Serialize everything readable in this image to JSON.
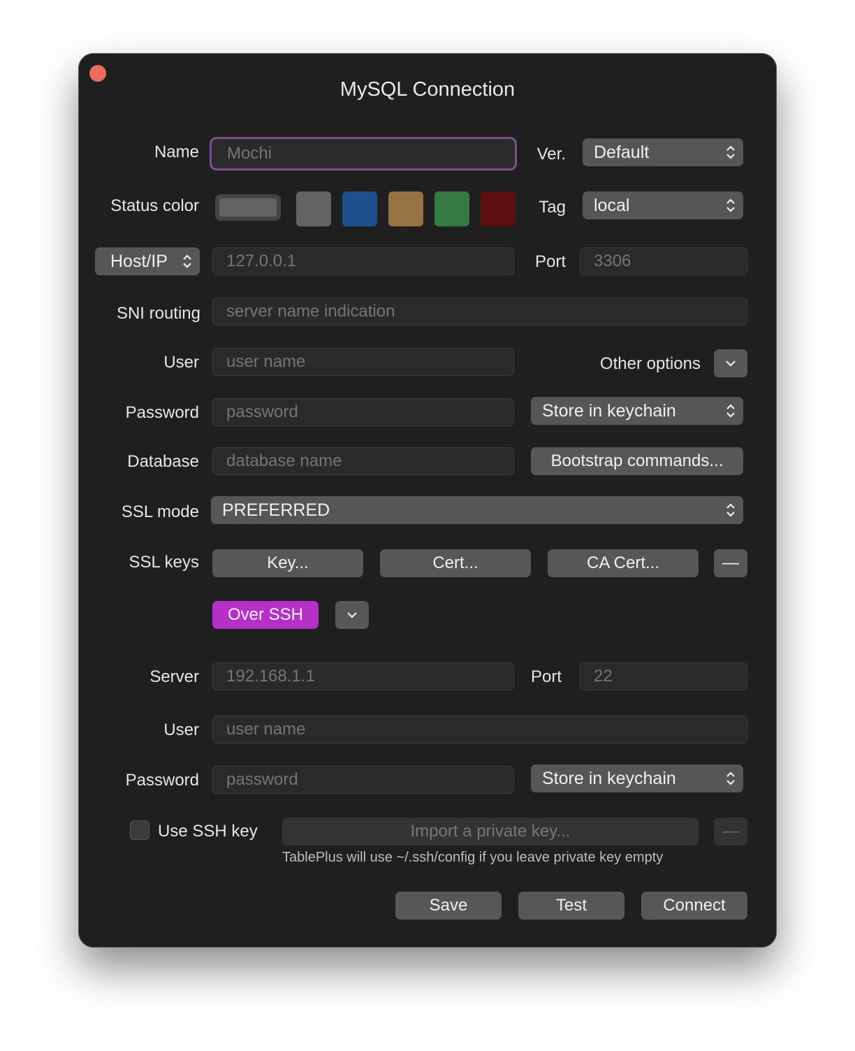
{
  "window": {
    "title": "MySQL Connection"
  },
  "colors": {
    "swatches": [
      "#636366",
      "#1f4f8f",
      "#967244",
      "#357a43",
      "#5c0f0e"
    ],
    "accent": "#b530c7"
  },
  "name": {
    "label": "Name",
    "placeholder": "Mochi"
  },
  "version": {
    "label": "Ver.",
    "value": "Default"
  },
  "status_color": {
    "label": "Status color"
  },
  "tag": {
    "label": "Tag",
    "value": "local"
  },
  "host": {
    "selector": "Host/IP",
    "placeholder": "127.0.0.1",
    "port_label": "Port",
    "port_placeholder": "3306"
  },
  "sni": {
    "label": "SNI routing",
    "placeholder": "server name indication"
  },
  "user": {
    "label": "User",
    "placeholder": "user name",
    "other_options": "Other options"
  },
  "password": {
    "label": "Password",
    "placeholder": "password",
    "store": "Store in keychain"
  },
  "database": {
    "label": "Database",
    "placeholder": "database name",
    "bootstrap": "Bootstrap commands..."
  },
  "ssl_mode": {
    "label": "SSL mode",
    "value": "PREFERRED"
  },
  "ssl_keys": {
    "label": "SSL keys",
    "key": "Key...",
    "cert": "Cert...",
    "ca_cert": "CA Cert...",
    "remove": "—"
  },
  "ssh": {
    "toggle": "Over SSH"
  },
  "ssh_server": {
    "label": "Server",
    "placeholder": "192.168.1.1",
    "port_label": "Port",
    "port_placeholder": "22"
  },
  "ssh_user": {
    "label": "User",
    "placeholder": "user name"
  },
  "ssh_password": {
    "label": "Password",
    "placeholder": "password",
    "store": "Store in keychain"
  },
  "ssh_key": {
    "label": "Use SSH key",
    "import": "Import a private key...",
    "remove": "—",
    "hint": "TablePlus will use ~/.ssh/config if you leave private key empty"
  },
  "footer": {
    "save": "Save",
    "test": "Test",
    "connect": "Connect"
  }
}
